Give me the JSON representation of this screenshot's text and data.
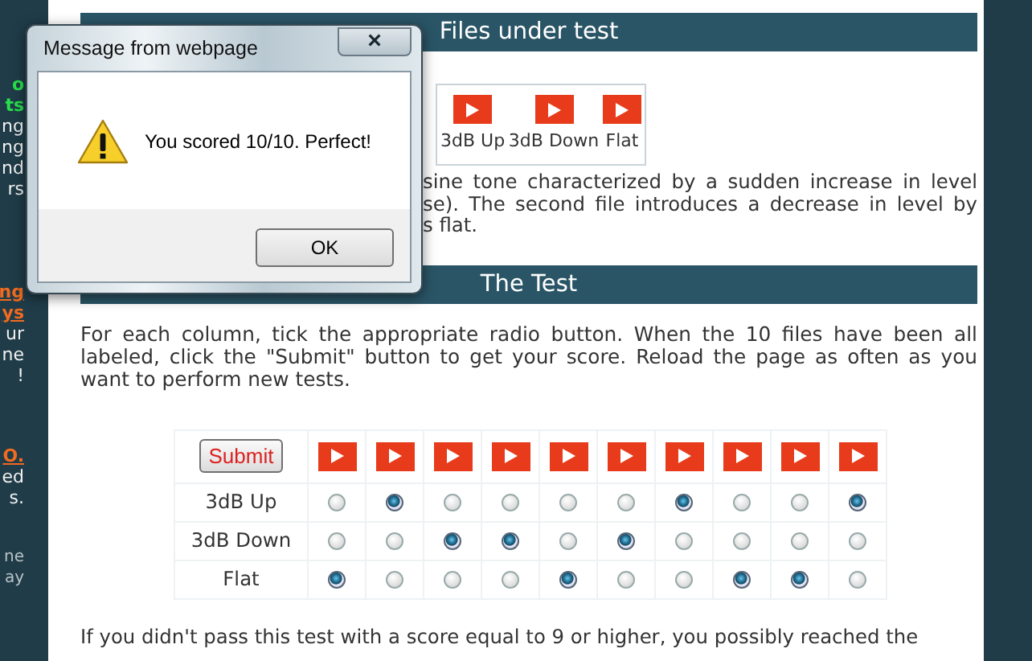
{
  "sidebar": {
    "groups": [
      {
        "lines": [
          {
            "text": "o",
            "kind": "heading"
          },
          {
            "text": "ts",
            "kind": "heading"
          },
          {
            "text": "ng",
            "kind": "text"
          },
          {
            "text": "ng",
            "kind": "text"
          },
          {
            "text": "nd",
            "kind": "text"
          },
          {
            "text": "rs",
            "kind": "text"
          }
        ]
      },
      {
        "lines": [
          {
            "text": "ng",
            "kind": "link"
          },
          {
            "text": "ys",
            "kind": "link"
          },
          {
            "text": "ur",
            "kind": "text"
          },
          {
            "text": "ne",
            "kind": "text"
          },
          {
            "text": "!",
            "kind": "text"
          }
        ]
      },
      {
        "lines": [
          {
            "text": "O.",
            "kind": "link"
          },
          {
            "text": "ed",
            "kind": "text"
          },
          {
            "text": "s.",
            "kind": "text"
          }
        ]
      },
      {
        "lines": [
          {
            "text": "ne",
            "kind": "note"
          },
          {
            "text": "ay",
            "kind": "note"
          }
        ]
      }
    ]
  },
  "files_section": {
    "title": "Files under test",
    "players": [
      {
        "label": "3dB Up"
      },
      {
        "label": "3dB Down"
      },
      {
        "label": "Flat"
      }
    ],
    "description_lines": [
      "sine tone characterized by a sudden increase in level",
      "se). The second file introduces a decrease in level by",
      "s flat."
    ]
  },
  "test_section": {
    "title": "The Test",
    "instructions": "For each column, tick the appropriate radio button. When the 10 files have been all labeled, click the \"Submit\" button to get your score. Reload the page as often as you want to perform new tests.",
    "submit_label": "Submit",
    "rows": [
      {
        "label": "3dB Up",
        "choices": [
          {
            "selected": false
          },
          {
            "selected": true
          },
          {
            "selected": false
          },
          {
            "selected": false
          },
          {
            "selected": false
          },
          {
            "selected": false
          },
          {
            "selected": true
          },
          {
            "selected": false
          },
          {
            "selected": false
          },
          {
            "selected": true
          }
        ]
      },
      {
        "label": "3dB Down",
        "choices": [
          {
            "selected": false
          },
          {
            "selected": false
          },
          {
            "selected": true
          },
          {
            "selected": true
          },
          {
            "selected": false
          },
          {
            "selected": true
          },
          {
            "selected": false
          },
          {
            "selected": false
          },
          {
            "selected": false
          },
          {
            "selected": false
          }
        ]
      },
      {
        "label": "Flat",
        "choices": [
          {
            "selected": true
          },
          {
            "selected": false
          },
          {
            "selected": false
          },
          {
            "selected": false
          },
          {
            "selected": true
          },
          {
            "selected": false
          },
          {
            "selected": false
          },
          {
            "selected": true
          },
          {
            "selected": true
          },
          {
            "selected": false
          }
        ]
      }
    ],
    "footer_text": "If you didn't pass this test with a score equal to 9 or higher, you possibly reached the"
  },
  "dialog": {
    "title": "Message from webpage",
    "close_label": "×",
    "message": "You scored 10/10. Perfect!",
    "ok_label": "OK"
  }
}
